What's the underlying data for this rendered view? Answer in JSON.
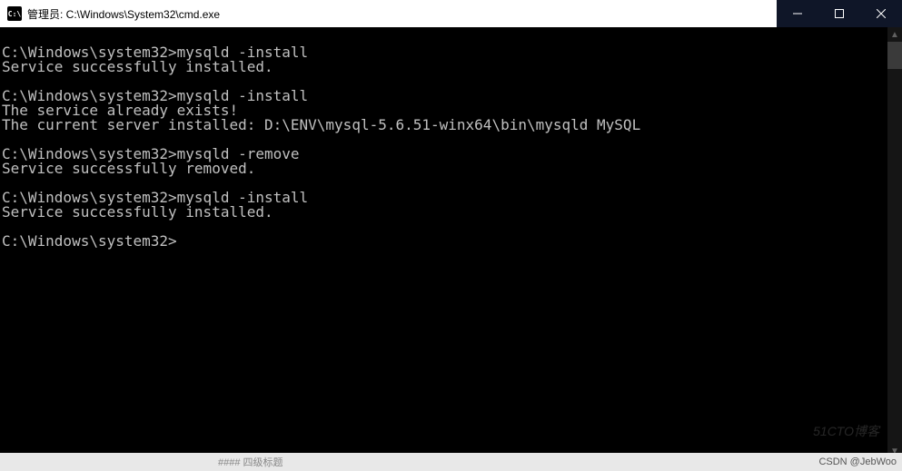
{
  "titlebar": {
    "icon_text": "C:\\",
    "title": "管理员: C:\\Windows\\System32\\cmd.exe"
  },
  "terminal": {
    "lines": [
      "",
      "C:\\Windows\\system32>mysqld -install",
      "Service successfully installed.",
      "",
      "C:\\Windows\\system32>mysqld -install",
      "The service already exists!",
      "The current server installed: D:\\ENV\\mysql-5.6.51-winx64\\bin\\mysqld MySQL",
      "",
      "C:\\Windows\\system32>mysqld -remove",
      "Service successfully removed.",
      "",
      "C:\\Windows\\system32>mysqld -install",
      "Service successfully installed.",
      "",
      "C:\\Windows\\system32>"
    ]
  },
  "watermark": {
    "br": "51CTO博客"
  },
  "bottombar": {
    "blur": "#### 四级标题",
    "right": "CSDN @JebWoo"
  }
}
